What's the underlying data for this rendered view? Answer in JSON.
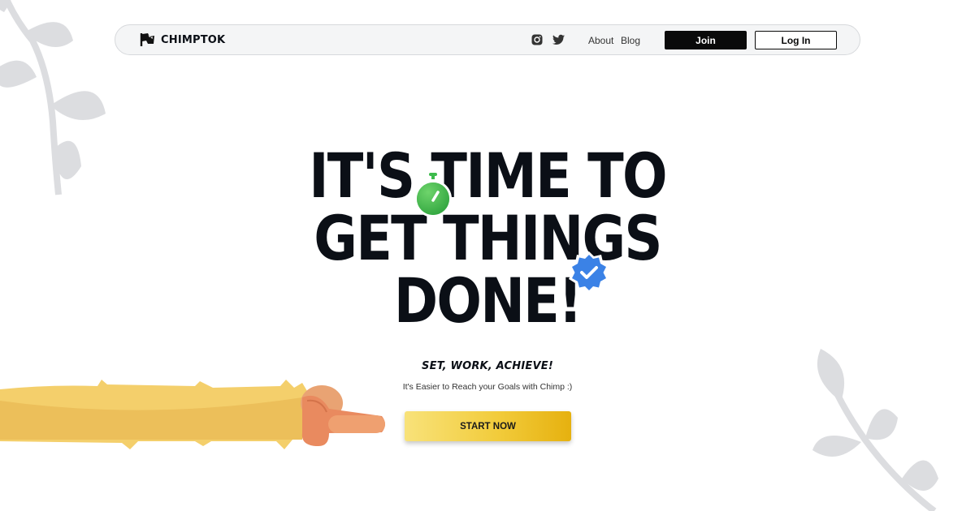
{
  "brand": {
    "name": "CHIMPTOK",
    "logo_icon": "flag-logo-icon"
  },
  "nav": {
    "social_icons": [
      "instagram-icon",
      "twitter-icon"
    ],
    "links": {
      "about": "About",
      "blog": "Blog"
    },
    "join_label": "Join",
    "login_label": "Log In"
  },
  "hero": {
    "title_lines": [
      "IT'S TIME TO",
      "GET THINGS",
      "DONE!"
    ],
    "tagline": "SET, WORK, ACHIEVE!",
    "subtext": "It's Easier to Reach your Goals with Chimp :)",
    "cta_label": "START NOW"
  },
  "colors": {
    "text": "#0b0f16",
    "button_dark": "#0a0a0a",
    "cta_gradient_start": "#f8e27a",
    "cta_gradient_end": "#e6b10f",
    "stopwatch_green": "#3dbb4c",
    "badge_blue": "#3b82e6",
    "leaf_gray": "#dcdde0",
    "arm_fur": "#f4cf6b",
    "hand": "#e98a5f"
  }
}
